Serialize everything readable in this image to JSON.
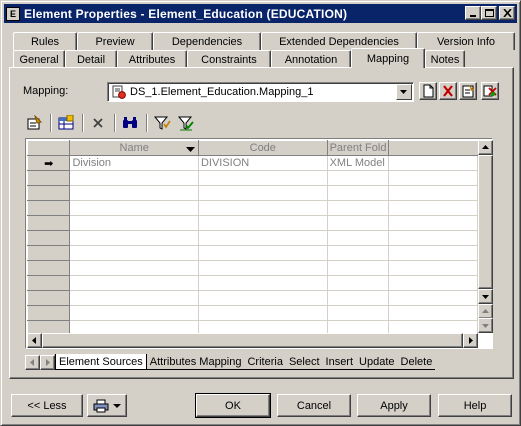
{
  "window": {
    "title": "Element Properties - Element_Education (EDUCATION)",
    "title_icon": "E"
  },
  "title_buttons": {
    "minimize": "minimize-icon",
    "maximize": "maximize-icon",
    "close": "close-icon"
  },
  "tabs_back": [
    "Rules",
    "Preview",
    "Dependencies",
    "Extended Dependencies",
    "Version Info"
  ],
  "tabs_front": [
    "General",
    "Detail",
    "Attributes",
    "Constraints",
    "Annotation",
    "Mapping",
    "Notes"
  ],
  "active_tab": "Mapping",
  "mapping": {
    "label": "Mapping:",
    "value": "DS_1.Element_Education.Mapping_1"
  },
  "grid": {
    "columns": [
      "Name",
      "Code",
      "Parent Fold"
    ],
    "rows": [
      {
        "marker": "➡",
        "name": "Division",
        "code": "DIVISION",
        "parent": "XML Model"
      }
    ],
    "empty_rows": 13
  },
  "subtabs": [
    "Element Sources",
    "Attributes Mapping",
    "Criteria",
    "Select",
    "Insert",
    "Update",
    "Delete"
  ],
  "active_subtab": "Element Sources",
  "buttons": {
    "less": "<< Less",
    "ok": "OK",
    "cancel": "Cancel",
    "apply": "Apply",
    "help": "Help"
  }
}
